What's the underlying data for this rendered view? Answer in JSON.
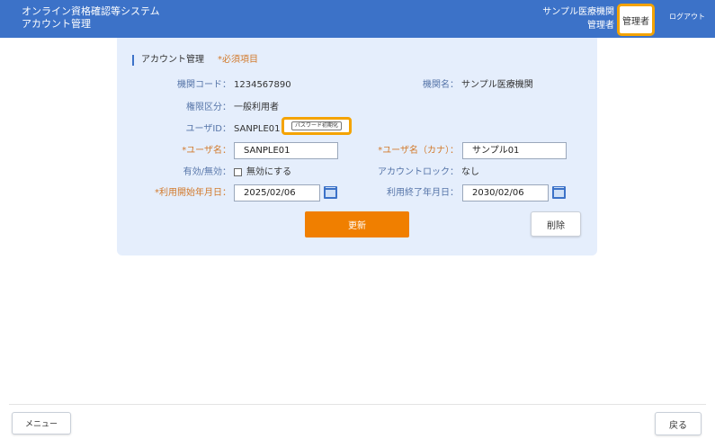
{
  "header": {
    "app_title_line1": "オンライン資格確認等システム",
    "app_title_line2": "アカウント管理",
    "org_name": "サンプル医療機関",
    "user_role": "管理者",
    "role_button": "管理者",
    "logout": "ログアウト"
  },
  "section": {
    "title": "アカウント管理",
    "required_note": "*必須項目"
  },
  "form": {
    "institution_code_label": "機関コード：",
    "institution_code_value": "1234567890",
    "institution_name_label": "機関名：",
    "institution_name_value": "サンプル医療機関",
    "permission_label": "権限区分：",
    "permission_value": "一般利用者",
    "user_id_label": "ユーザID：",
    "user_id_value": "SANPLE01",
    "password_reset": "パスワード初期化",
    "username_label": "*ユーザ名：",
    "username_value": "SANPLE01",
    "username_kana_label": "*ユーザ名（カナ）：",
    "username_kana_value": "サンプル01",
    "enabled_label": "有効/無効：",
    "disable_checkbox_label": "無効にする",
    "account_lock_label": "アカウントロック：",
    "account_lock_value": "なし",
    "start_date_label": "*利用開始年月日：",
    "start_date_value": "2025/02/06",
    "end_date_label": "利用終了年月日：",
    "end_date_value": "2030/02/06"
  },
  "buttons": {
    "update": "更新",
    "delete": "削除",
    "menu": "メニュー",
    "back": "戻る"
  },
  "colors": {
    "header_bg": "#3c72c8",
    "panel_bg": "#e5eefc",
    "primary_button": "#f07f00",
    "highlight": "#f4a300",
    "required": "#d27a2c"
  }
}
